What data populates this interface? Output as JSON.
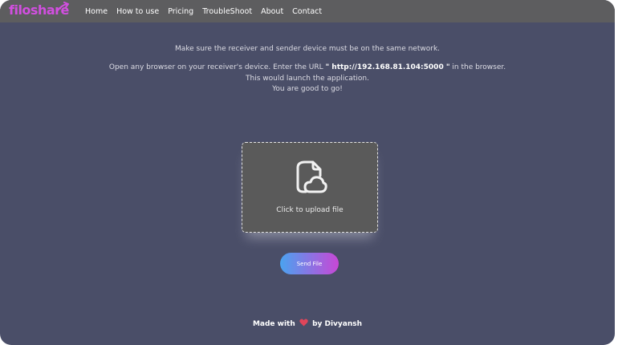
{
  "brand": {
    "logo_text": "filoshare",
    "accent_color": "#d24fe0"
  },
  "nav": {
    "links": [
      {
        "label": "Home"
      },
      {
        "label": "How to use"
      },
      {
        "label": "Pricing"
      },
      {
        "label": "TroubleShoot"
      },
      {
        "label": "About"
      },
      {
        "label": "Contact"
      }
    ]
  },
  "instructions": {
    "line1": "Make sure the receiver and sender device must be on the same network.",
    "line2_prefix": "Open any browser on your receiver's device. Enter the URL ",
    "line2_url": "\" http://192.168.81.104:5000 \"",
    "line2_suffix": " in the browser.",
    "line3": "This would launch the application.",
    "line4": "You are good to go!"
  },
  "upload": {
    "icon": "file-cloud-icon",
    "label": "Click to upload file"
  },
  "send_button": {
    "label": "Send File",
    "gradient_start": "#4aa3f0",
    "gradient_end": "#c847d6"
  },
  "footer": {
    "prefix": "Made with",
    "icon": "heart-icon",
    "suffix": "by Divyansh"
  }
}
